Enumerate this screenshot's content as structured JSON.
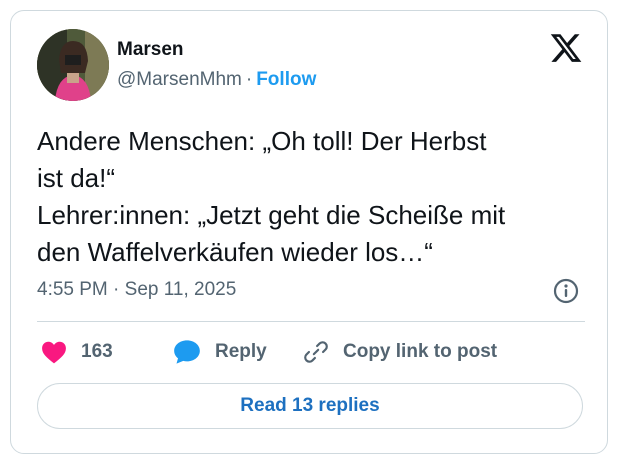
{
  "author": {
    "name": "Marsen",
    "handle": "@MarsenMhm",
    "separator": "·",
    "follow_label": "Follow"
  },
  "tweet": {
    "lines": [
      "Andere Menschen: „Oh toll! Der Herbst",
      "ist da!“",
      "Lehrer:innen: „Jetzt geht die Scheiße mit",
      "den Waffelverkäufen wieder los…“"
    ],
    "timestamp": "4:55 PM · Sep 11, 2025"
  },
  "actions": {
    "like_count": "163",
    "reply_label": "Reply",
    "copy_label": "Copy link to post"
  },
  "read_replies_label": "Read 13 replies",
  "icons": {
    "logo": "x-logo-icon",
    "info": "info-icon",
    "like": "heart-icon",
    "reply": "speech-bubble-icon",
    "copy": "link-icon"
  },
  "colors": {
    "accent": "#1d9bf0",
    "like": "#f91880",
    "secondary_text": "#536471",
    "border": "#cfd9de"
  }
}
